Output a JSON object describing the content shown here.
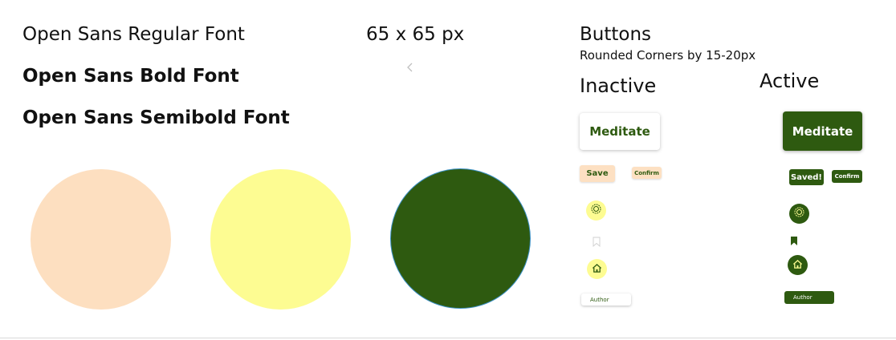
{
  "fonts": {
    "regular_label": "Open Sans Regular Font",
    "bold_label": "Open Sans Bold Font",
    "semibold_label": "Open Sans Semibold Font"
  },
  "size_label": "65 x 65 px",
  "icons": {
    "back": "chevron-left-icon",
    "settings": "gear-icon",
    "bookmark": "bookmark-icon",
    "home": "home-icon"
  },
  "swatches": [
    {
      "name": "peach",
      "color": "#fddfc0"
    },
    {
      "name": "light-yellow",
      "color": "#fdfc92"
    },
    {
      "name": "dark-green",
      "color": "#2e5a10"
    }
  ],
  "buttons_section": {
    "title": "Buttons",
    "subtitle": "Rounded Corners by 15-20px",
    "inactive_heading": "Inactive",
    "active_heading": "Active"
  },
  "inactive": {
    "meditate_label": "Meditate",
    "save_label": "Save",
    "confirm_label": "Confirm",
    "author_label": "Author"
  },
  "active": {
    "meditate_label": "Meditate",
    "saved_label": "Saved!",
    "confirm_label": "Confirm",
    "author_label": "Author"
  },
  "colors": {
    "primary_dark_green": "#2e5a10",
    "peach": "#fddfc0",
    "light_yellow": "#fdfc92",
    "circle_outline": "#3b90c4"
  }
}
